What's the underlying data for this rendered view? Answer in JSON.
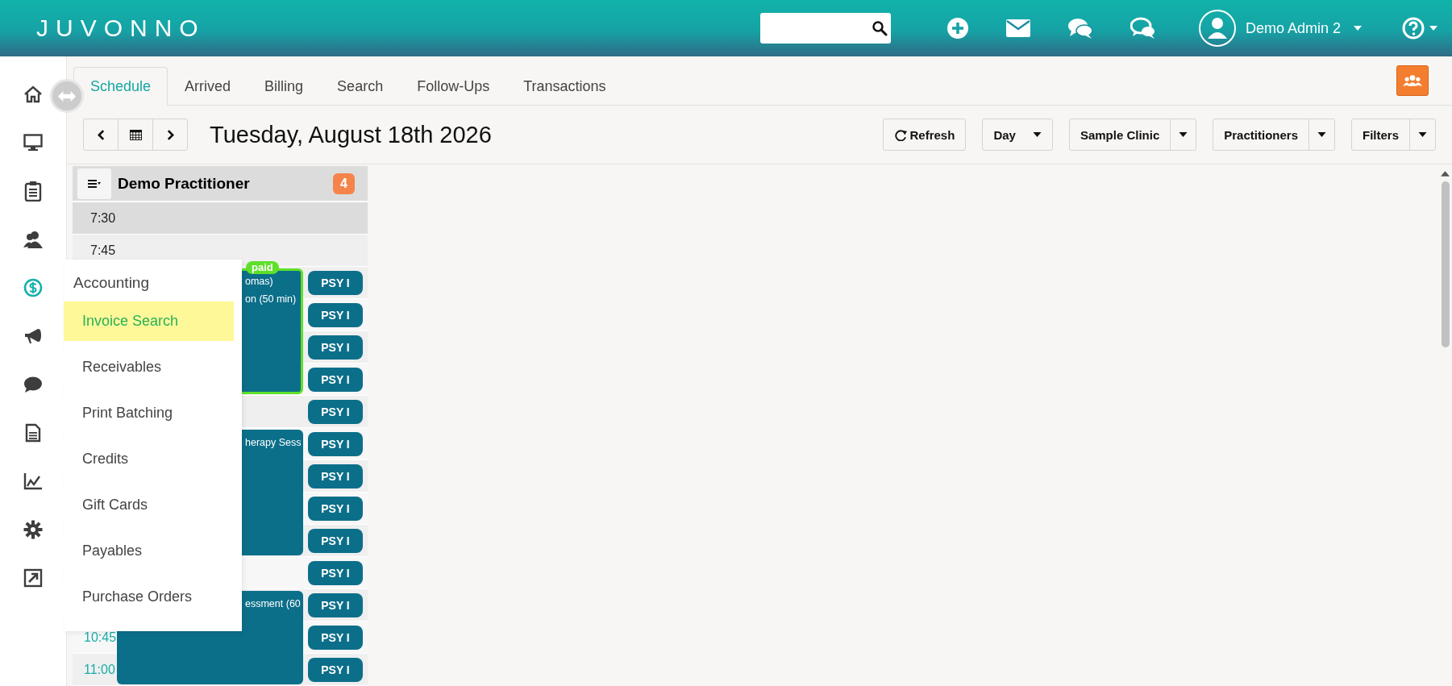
{
  "header": {
    "logo": "JUVONNO",
    "user": {
      "name": "Demo Admin 2"
    }
  },
  "sidebar": {
    "items": [
      {
        "selected": false
      },
      {
        "selected": false
      },
      {
        "selected": false
      },
      {
        "selected": false
      },
      {
        "selected": true
      },
      {
        "selected": false
      },
      {
        "selected": false
      },
      {
        "selected": false
      },
      {
        "selected": false
      },
      {
        "selected": false
      },
      {
        "selected": false
      }
    ]
  },
  "tabs": [
    {
      "label": "Schedule",
      "selected": true
    },
    {
      "label": "Arrived",
      "selected": false
    },
    {
      "label": "Billing",
      "selected": false
    },
    {
      "label": "Search",
      "selected": false
    },
    {
      "label": "Follow-Ups",
      "selected": false
    },
    {
      "label": "Transactions",
      "selected": false
    }
  ],
  "toolbar": {
    "date": "Tuesday, August 18th 2026",
    "buttons": [
      {
        "label": "Refresh",
        "kind": "refresh"
      },
      {
        "label": "Day",
        "kind": "dropdown"
      },
      {
        "label": "Sample Clinic",
        "kind": "split"
      },
      {
        "label": "Practitioners",
        "kind": "split"
      },
      {
        "label": "Filters",
        "kind": "split"
      }
    ]
  },
  "schedule": {
    "practitioner": "Demo Practitioner",
    "count": "4",
    "slots": [
      {
        "kind": "empty",
        "rows": [
          {
            "time": "7:30",
            "highlighted": false
          }
        ]
      },
      {
        "kind": "empty",
        "rows": [
          {
            "time": "7:45",
            "highlighted": false
          }
        ]
      },
      {
        "kind": "appointment",
        "paid": true,
        "badge": "paid",
        "lines": [
          "omas)",
          "on (50 min)"
        ],
        "rows": [
          {
            "resource": "PSY I"
          },
          {
            "resource": "PSY I"
          },
          {
            "resource": "PSY I"
          },
          {
            "resource": "PSY I"
          }
        ]
      },
      {
        "kind": "empty",
        "rows": [
          {
            "resource": "PSY I"
          }
        ]
      },
      {
        "kind": "appointment",
        "paid": false,
        "lines": [
          "herapy Sess"
        ],
        "rows": [
          {
            "resource": "PSY I"
          },
          {
            "resource": "PSY I"
          },
          {
            "resource": "PSY I"
          },
          {
            "resource": "PSY I"
          }
        ]
      },
      {
        "kind": "empty",
        "rows": [
          {
            "resource": "PSY I"
          }
        ]
      },
      {
        "kind": "appointment",
        "paid": false,
        "lines": [
          "essment (60"
        ],
        "rows": [
          {
            "resource": "PSY I"
          },
          {
            "time": "10:45",
            "highlighted": true,
            "resource": "PSY I"
          },
          {
            "time": "11:00",
            "highlighted": true,
            "resource": "PSY I"
          }
        ]
      }
    ]
  },
  "menu": {
    "title": "Accounting",
    "items": [
      {
        "label": "Invoice Search",
        "selected": true
      },
      {
        "label": "Receivables",
        "selected": false
      },
      {
        "label": "Print Batching",
        "selected": false
      },
      {
        "label": "Credits",
        "selected": false
      },
      {
        "label": "Gift Cards",
        "selected": false
      },
      {
        "label": "Payables",
        "selected": false
      },
      {
        "label": "Purchase Orders",
        "selected": false
      }
    ]
  }
}
